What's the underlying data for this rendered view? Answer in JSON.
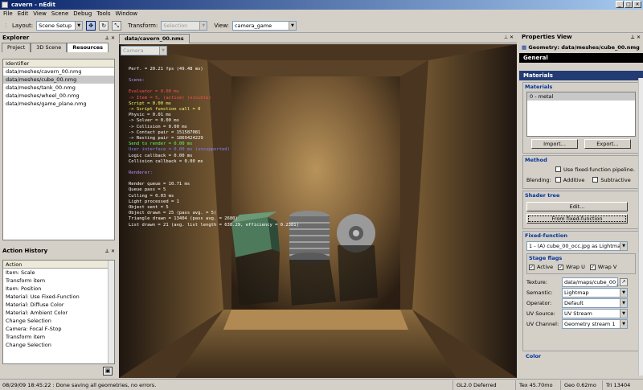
{
  "window": {
    "title": "cavern - nEdit",
    "min": "_",
    "max": "□",
    "close": "✕"
  },
  "menu": [
    "File",
    "Edit",
    "View",
    "Scene",
    "Debug",
    "Tools",
    "Window"
  ],
  "toolbar": {
    "layout_label": "Layout:",
    "layout_value": "Scene Setup",
    "transform_label": "Transform:",
    "transform_value": "Selection",
    "view_label": "View:",
    "view_value": "camera_game"
  },
  "explorer": {
    "title": "Explorer",
    "tabs": [
      "Project",
      "3D Scene",
      "Resources"
    ],
    "column": "Identifier",
    "items": [
      "data/meshes/cavern_00.nmg",
      "data/meshes/cube_00.nmg",
      "data/meshes/tank_00.nmg",
      "data/meshes/wheel_00.nmg",
      "data/meshes/game_plane.nmg"
    ]
  },
  "history": {
    "title": "Action History",
    "column": "Action",
    "items": [
      "Item: Scale",
      "Transform item",
      "Item: Position",
      "Material: Use Fixed-Function",
      "Material: Diffuse Color",
      "Material: Ambient Color",
      "Change Selection",
      "Camera: Focal F-Stop",
      "Transform item",
      "Change Selection"
    ]
  },
  "doc": {
    "tab": "data/cavern_00.nms",
    "camera_combo": "Camera",
    "stats": {
      "perf": "Perf. = 20.21 fps (49.48 ms)",
      "scene_title": "Scene:",
      "evaluator": "Evaluator = 0.00 ms",
      "item": " -> Item = 5, (active) (visible)",
      "script": "Script = 0.00 ms",
      "script_calls": " -> Script function call = 0",
      "physic": "Physic = 0.01 ms",
      "solver": " -> Solver = 0.00 ms",
      "collision": " -> Collision = 0.00 ms",
      "contact": " -> Contact pair = 151587081",
      "resting": " -> Resting pair = 1869424229",
      "send": "Send to render = 0.00 ms",
      "ui": "User interface = 0.00 ms (unsupported)",
      "logic": "Logic callback = 0.00 ms",
      "collision_cb": "Collision callback = 0.00 ms",
      "renderer_title": "Renderer:",
      "queue": "Render queue = 10.71 ms",
      "passes": "Queue pass = 5",
      "culling": "Culling = 0.03 ms",
      "lights": "Light processed = 1",
      "objects_sent": "Object sent = 5",
      "objects_drawn": "Object drawn = 25 (pass avg. = 5)",
      "triangles": "Triangle drawn = 13404 (pass avg. = 2680)",
      "lists": "List drawn = 21 (avg. list length = 638.29, efficiency = 0.2381)"
    }
  },
  "properties": {
    "title": "Properties View",
    "geometry": "Geometry: data/meshes/cube_00.nmg",
    "general": "General",
    "materials_hdr": "Materials",
    "materials_group": "Materials",
    "material_item": "0 - metal",
    "import": "Import...",
    "export": "Export...",
    "method": "Method",
    "fixed_pipeline": "Use fixed-function pipeline.",
    "blending": "Blending:",
    "additive": "Additive",
    "subtractive": "Subtractive",
    "shader_tree": "Shader tree",
    "edit": "Edit...",
    "from_fixed": "From fixed-function",
    "fixed_function": "Fixed-function",
    "stage_combo": "1 - (A) cube_00_occ.jpg as Lightmap",
    "stage_flags": "Stage flags",
    "active": "Active",
    "wrap_u": "Wrap U",
    "wrap_v": "Wrap V",
    "texture_label": "Texture:",
    "texture_value": "data/maps/cube_00_",
    "semantic_label": "Semantic:",
    "semantic_value": "Lightmap",
    "operator_label": "Operator:",
    "operator_value": "Default",
    "uvsource_label": "UV Source:",
    "uvsource_value": "UV Stream",
    "uvchannel_label": "UV Channel:",
    "uvchannel_value": "Geometry stream 1",
    "color": "Color"
  },
  "status": {
    "message": "08/29/09 18:45:22 : Done saving all geometries, no errors.",
    "renderer": "GL2.0 Deferred",
    "tex": "Tex 45.70mo",
    "geo": "Geo 0.62mo",
    "tri": "Tri 13404"
  }
}
